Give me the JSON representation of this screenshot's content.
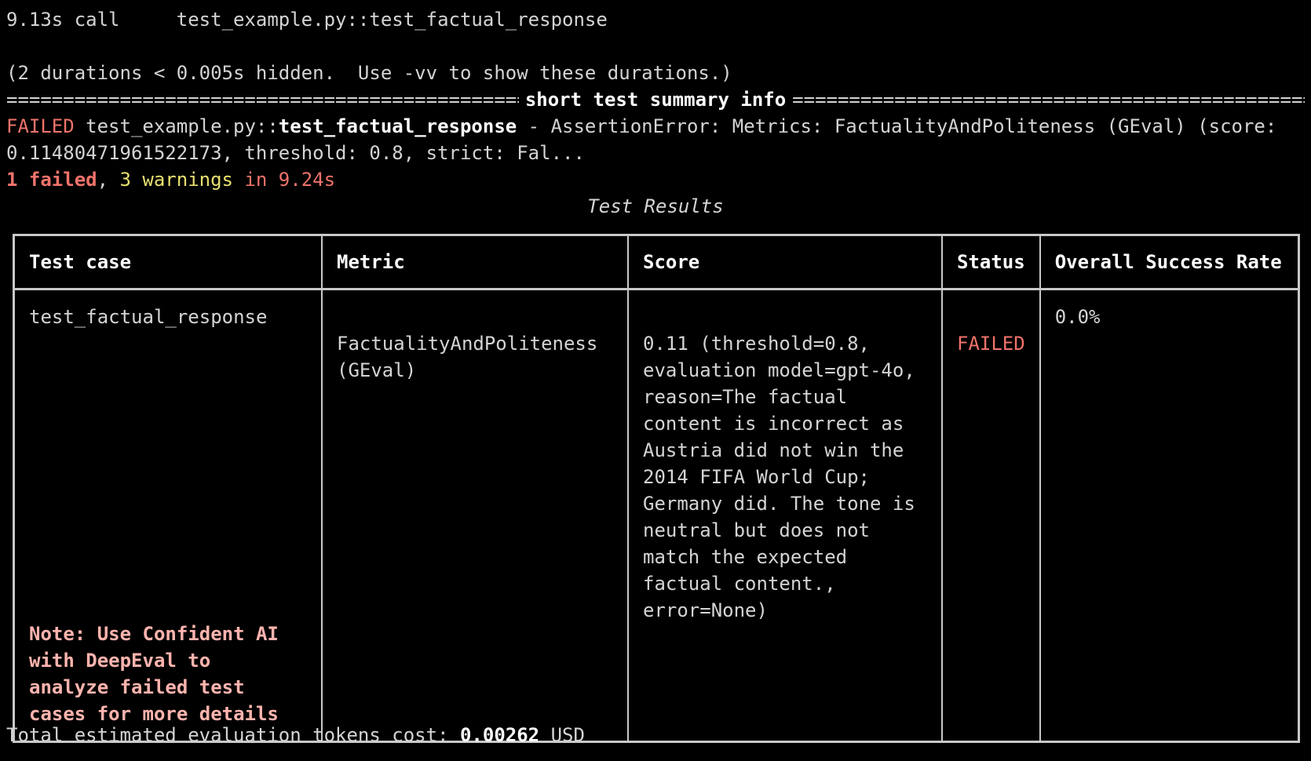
{
  "terminal": {
    "durations_line": "9.13s call     test_example.py::test_factual_response",
    "hidden_line": "(2 durations < 0.005s hidden.  Use -vv to show these durations.)",
    "separator_fill": "=================================================================================================================",
    "separator_title": "short test summary info",
    "failed_label": "FAILED",
    "failed_path_prefix": "test_example.py::",
    "failed_test_name": "test_factual_response",
    "failed_message": " - AssertionError: Metrics: FactualityAndPoliteness (GEval) (score: 0.11480471961522173, threshold: 0.8, strict: Fal...",
    "summary_failed": "1 failed",
    "summary_sep": ", ",
    "summary_warnings": "3 warnings",
    "summary_time": " in 9.24s"
  },
  "results": {
    "caption": "Test Results",
    "headers": {
      "test_case": "Test case",
      "metric": "Metric",
      "score": "Score",
      "status": "Status",
      "success_rate": "Overall Success Rate"
    },
    "row": {
      "test_case": "test_factual_response",
      "note": "Note: Use Confident AI with DeepEval to analyze failed test cases for more details",
      "metric": "FactualityAndPoliteness (GEval)",
      "score": "0.11 (threshold=0.8, evaluation model=gpt-4o, reason=The factual content is incorrect as Austria did not win the 2014 FIFA World Cup; Germany did. The tone is neutral but does not match the expected factual content., error=None)",
      "status": "FAILED",
      "success_rate": "0.0%"
    }
  },
  "footer": {
    "prefix": "Total estimated evaluation tokens cost: ",
    "cost": "0.00262",
    "unit": " USD"
  },
  "colors": {
    "background": "#000000",
    "text": "#d4d4d4",
    "failed": "#f0736b",
    "warning": "#e8e070",
    "note": "#ffb4ae"
  }
}
